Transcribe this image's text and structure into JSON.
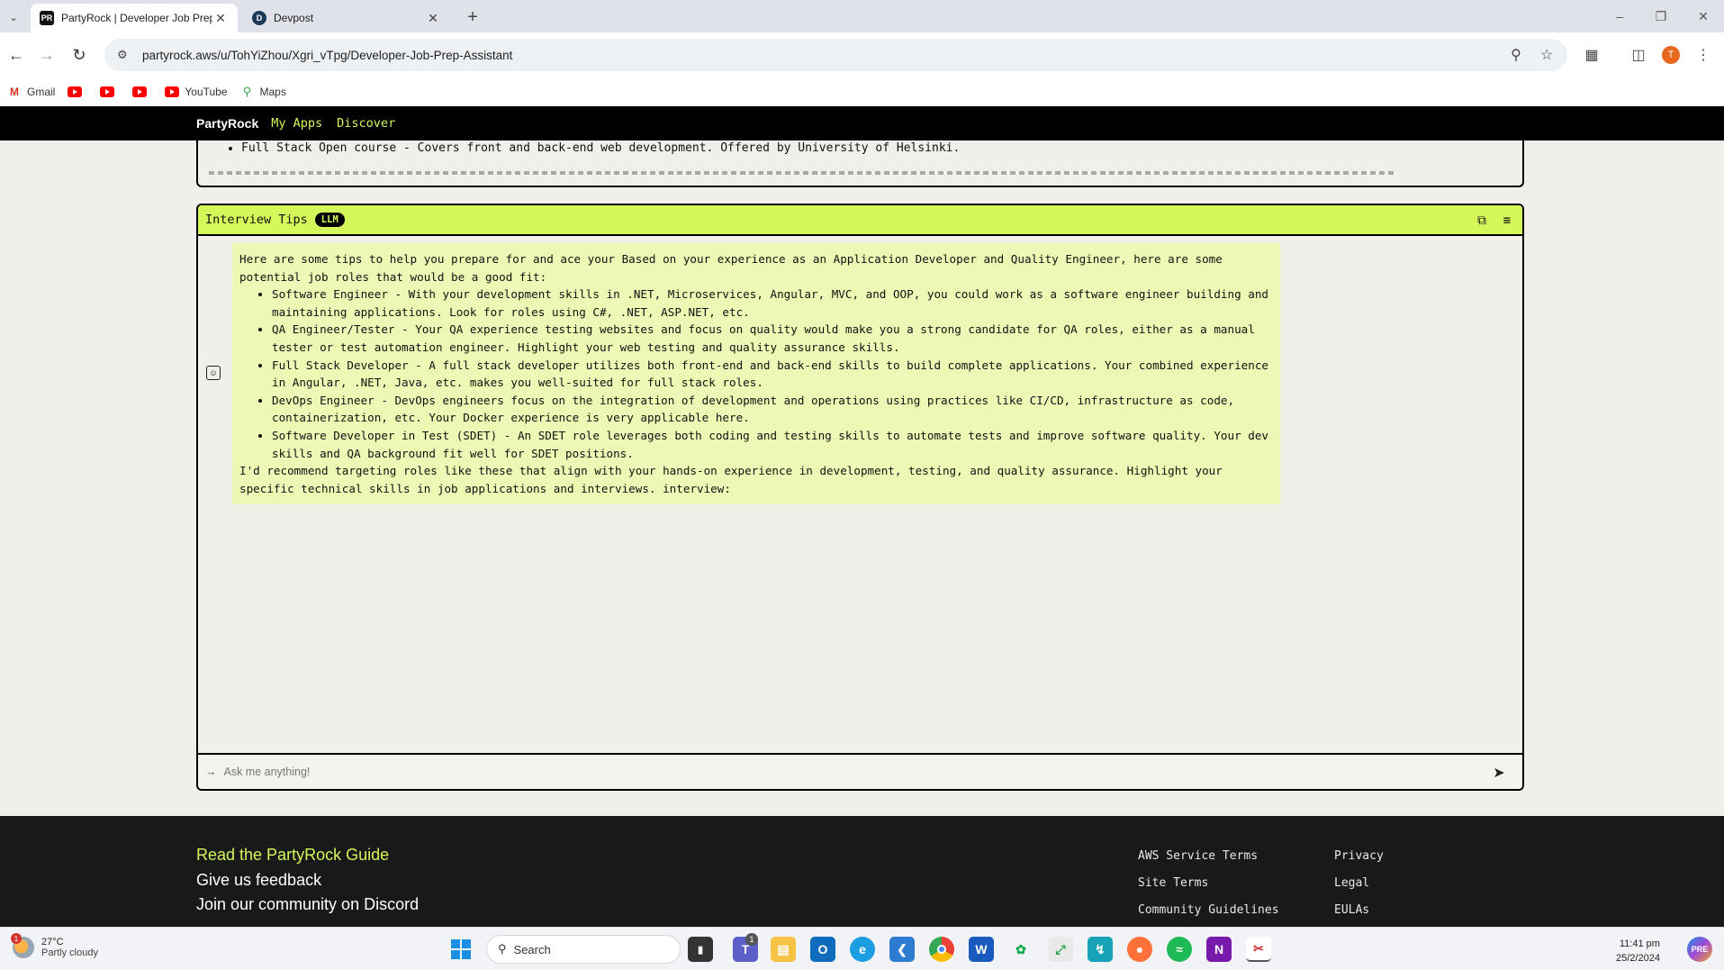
{
  "browser": {
    "tabs": [
      {
        "title": "PartyRock | Developer Job Prep",
        "favicon": "PR",
        "active": true
      },
      {
        "title": "Devpost",
        "favicon": "D",
        "active": false
      }
    ],
    "url": "partyrock.aws/u/TohYiZhou/Xgri_vTpg/Developer-Job-Prep-Assistant",
    "profile_initial": "T",
    "bookmarks": [
      "Gmail",
      "",
      "",
      "",
      "YouTube",
      "Maps"
    ]
  },
  "app": {
    "brand": "PartyRock",
    "nav": [
      "My Apps",
      "Discover"
    ],
    "previous_card": {
      "bullet": "Full Stack Open course - Covers front and back-end web development. Offered by University of Helsinki."
    },
    "widget": {
      "title": "Interview Tips",
      "badge": "LLM",
      "response": {
        "intro": "Here are some tips to help you prepare for and ace your Based on your experience as an Application Developer and Quality Engineer, here are some potential job roles that would be a good fit:",
        "items": [
          "Software Engineer - With your development skills in .NET, Microservices, Angular, MVC, and OOP, you could work as a software engineer building and maintaining applications. Look for roles using C#, .NET, ASP.NET, etc.",
          "QA Engineer/Tester - Your QA experience testing websites and focus on quality would make you a strong candidate for QA roles, either as a manual tester or test automation engineer. Highlight your web testing and quality assurance skills.",
          "Full Stack Developer - A full stack developer utilizes both front-end and back-end skills to build complete applications. Your combined experience in Angular, .NET, Java, etc. makes you well-suited for full stack roles.",
          "DevOps Engineer - DevOps engineers focus on the integration of development and operations using practices like CI/CD, infrastructure as code, containerization, etc. Your Docker experience is very applicable here.",
          "Software Developer in Test (SDET) - An SDET role leverages both coding and testing skills to automate tests and improve software quality. Your dev skills and QA background fit well for SDET positions."
        ],
        "outro": "I'd recommend targeting roles like these that align with your hands-on experience in development, testing, and quality assurance. Highlight your specific technical skills in job applications and interviews. interview:"
      },
      "input_placeholder": "Ask me anything!"
    }
  },
  "footer": {
    "left_links": [
      "Read the PartyRock Guide",
      "Give us feedback",
      "Join our community on Discord"
    ],
    "col1": [
      "AWS Service Terms",
      "Site Terms",
      "Community Guidelines"
    ],
    "col2": [
      "Privacy",
      "Legal",
      "EULAs"
    ]
  },
  "taskbar": {
    "weather_temp": "27°C",
    "weather_desc": "Partly cloudy",
    "weather_alert": "1",
    "search_placeholder": "Search",
    "teams_badge": "1",
    "time": "11:41 pm",
    "date": "25/2/2024"
  },
  "colors": {
    "accent": "#d4f75a",
    "response_bg": "#ecf9b4",
    "nav_bg": "#000000",
    "page_bg": "#f0efe9"
  }
}
